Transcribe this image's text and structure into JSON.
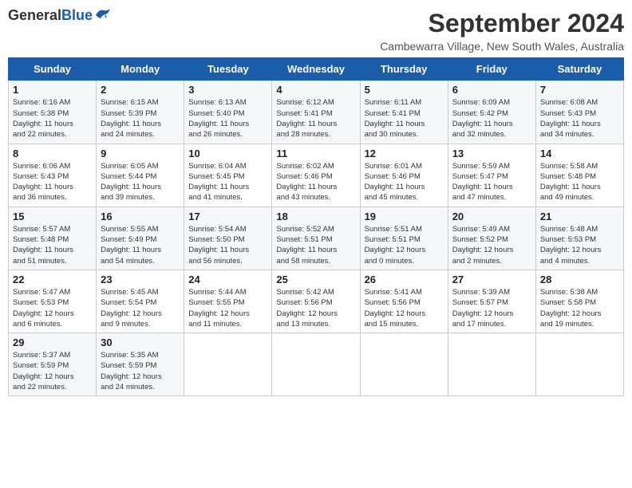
{
  "header": {
    "logo_general": "General",
    "logo_blue": "Blue",
    "month_title": "September 2024",
    "location": "Cambewarra Village, New South Wales, Australia"
  },
  "days_of_week": [
    "Sunday",
    "Monday",
    "Tuesday",
    "Wednesday",
    "Thursday",
    "Friday",
    "Saturday"
  ],
  "weeks": [
    [
      {
        "day": "1",
        "sunrise": "6:16 AM",
        "sunset": "5:38 PM",
        "daylight": "11 hours and 22 minutes."
      },
      {
        "day": "2",
        "sunrise": "6:15 AM",
        "sunset": "5:39 PM",
        "daylight": "11 hours and 24 minutes."
      },
      {
        "day": "3",
        "sunrise": "6:13 AM",
        "sunset": "5:40 PM",
        "daylight": "11 hours and 26 minutes."
      },
      {
        "day": "4",
        "sunrise": "6:12 AM",
        "sunset": "5:41 PM",
        "daylight": "11 hours and 28 minutes."
      },
      {
        "day": "5",
        "sunrise": "6:11 AM",
        "sunset": "5:41 PM",
        "daylight": "11 hours and 30 minutes."
      },
      {
        "day": "6",
        "sunrise": "6:09 AM",
        "sunset": "5:42 PM",
        "daylight": "11 hours and 32 minutes."
      },
      {
        "day": "7",
        "sunrise": "6:08 AM",
        "sunset": "5:43 PM",
        "daylight": "11 hours and 34 minutes."
      }
    ],
    [
      {
        "day": "8",
        "sunrise": "6:06 AM",
        "sunset": "5:43 PM",
        "daylight": "11 hours and 36 minutes."
      },
      {
        "day": "9",
        "sunrise": "6:05 AM",
        "sunset": "5:44 PM",
        "daylight": "11 hours and 39 minutes."
      },
      {
        "day": "10",
        "sunrise": "6:04 AM",
        "sunset": "5:45 PM",
        "daylight": "11 hours and 41 minutes."
      },
      {
        "day": "11",
        "sunrise": "6:02 AM",
        "sunset": "5:46 PM",
        "daylight": "11 hours and 43 minutes."
      },
      {
        "day": "12",
        "sunrise": "6:01 AM",
        "sunset": "5:46 PM",
        "daylight": "11 hours and 45 minutes."
      },
      {
        "day": "13",
        "sunrise": "5:59 AM",
        "sunset": "5:47 PM",
        "daylight": "11 hours and 47 minutes."
      },
      {
        "day": "14",
        "sunrise": "5:58 AM",
        "sunset": "5:48 PM",
        "daylight": "11 hours and 49 minutes."
      }
    ],
    [
      {
        "day": "15",
        "sunrise": "5:57 AM",
        "sunset": "5:48 PM",
        "daylight": "11 hours and 51 minutes."
      },
      {
        "day": "16",
        "sunrise": "5:55 AM",
        "sunset": "5:49 PM",
        "daylight": "11 hours and 54 minutes."
      },
      {
        "day": "17",
        "sunrise": "5:54 AM",
        "sunset": "5:50 PM",
        "daylight": "11 hours and 56 minutes."
      },
      {
        "day": "18",
        "sunrise": "5:52 AM",
        "sunset": "5:51 PM",
        "daylight": "11 hours and 58 minutes."
      },
      {
        "day": "19",
        "sunrise": "5:51 AM",
        "sunset": "5:51 PM",
        "daylight": "12 hours and 0 minutes."
      },
      {
        "day": "20",
        "sunrise": "5:49 AM",
        "sunset": "5:52 PM",
        "daylight": "12 hours and 2 minutes."
      },
      {
        "day": "21",
        "sunrise": "5:48 AM",
        "sunset": "5:53 PM",
        "daylight": "12 hours and 4 minutes."
      }
    ],
    [
      {
        "day": "22",
        "sunrise": "5:47 AM",
        "sunset": "5:53 PM",
        "daylight": "12 hours and 6 minutes."
      },
      {
        "day": "23",
        "sunrise": "5:45 AM",
        "sunset": "5:54 PM",
        "daylight": "12 hours and 9 minutes."
      },
      {
        "day": "24",
        "sunrise": "5:44 AM",
        "sunset": "5:55 PM",
        "daylight": "12 hours and 11 minutes."
      },
      {
        "day": "25",
        "sunrise": "5:42 AM",
        "sunset": "5:56 PM",
        "daylight": "12 hours and 13 minutes."
      },
      {
        "day": "26",
        "sunrise": "5:41 AM",
        "sunset": "5:56 PM",
        "daylight": "12 hours and 15 minutes."
      },
      {
        "day": "27",
        "sunrise": "5:39 AM",
        "sunset": "5:57 PM",
        "daylight": "12 hours and 17 minutes."
      },
      {
        "day": "28",
        "sunrise": "5:38 AM",
        "sunset": "5:58 PM",
        "daylight": "12 hours and 19 minutes."
      }
    ],
    [
      {
        "day": "29",
        "sunrise": "5:37 AM",
        "sunset": "5:59 PM",
        "daylight": "12 hours and 22 minutes."
      },
      {
        "day": "30",
        "sunrise": "5:35 AM",
        "sunset": "5:59 PM",
        "daylight": "12 hours and 24 minutes."
      },
      null,
      null,
      null,
      null,
      null
    ]
  ]
}
